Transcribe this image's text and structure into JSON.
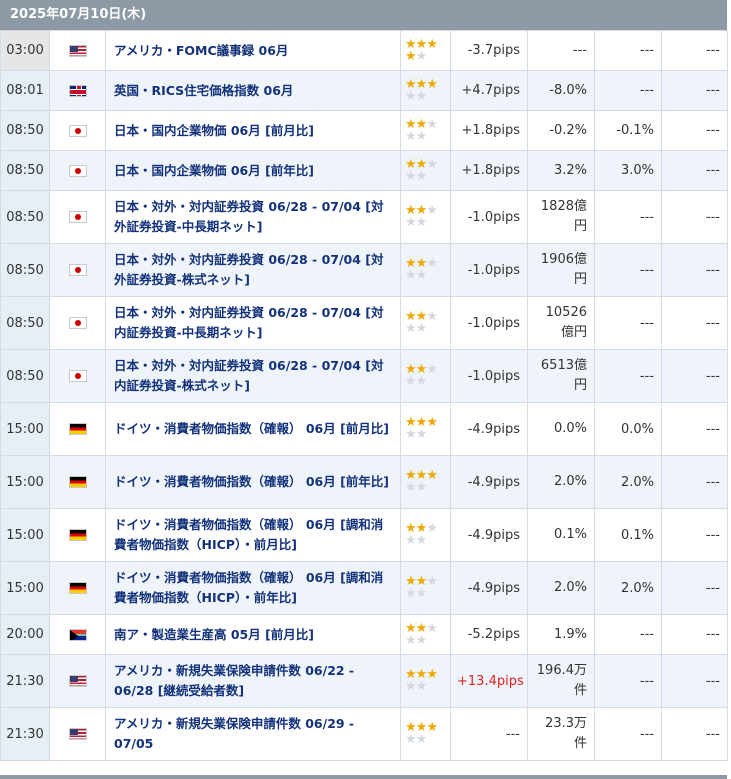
{
  "date_header": "2025年07月10日(木)",
  "rows": [
    {
      "time": "03:00",
      "country": "us",
      "name": "アメリカ・FOMC議事録 06月",
      "stars": 4,
      "pips": "-3.7pips",
      "pips_positive": false,
      "actual": "---",
      "forecast": "---",
      "previous": "---"
    },
    {
      "time": "08:01",
      "country": "gb",
      "name": "英国・RICS住宅価格指数 06月",
      "stars": 3,
      "pips": "+4.7pips",
      "pips_positive": false,
      "actual": "-8.0%",
      "forecast": "---",
      "previous": "---"
    },
    {
      "time": "08:50",
      "country": "jp",
      "name": "日本・国内企業物価 06月 [前月比]",
      "stars": 2,
      "pips": "+1.8pips",
      "pips_positive": false,
      "actual": "-0.2%",
      "forecast": "-0.1%",
      "previous": "---"
    },
    {
      "time": "08:50",
      "country": "jp",
      "name": "日本・国内企業物価 06月 [前年比]",
      "stars": 2,
      "pips": "+1.8pips",
      "pips_positive": false,
      "actual": "3.2%",
      "forecast": "3.0%",
      "previous": "---"
    },
    {
      "time": "08:50",
      "country": "jp",
      "name": "日本・対外・対内証券投資 06/28 - 07/04 [対外証券投資-中長期ネット]",
      "stars": 2,
      "pips": "-1.0pips",
      "pips_positive": false,
      "actual": "1828億円",
      "forecast": "---",
      "previous": "---"
    },
    {
      "time": "08:50",
      "country": "jp",
      "name": "日本・対外・対内証券投資 06/28 - 07/04 [対外証券投資-株式ネット]",
      "stars": 2,
      "pips": "-1.0pips",
      "pips_positive": false,
      "actual": "1906億円",
      "forecast": "---",
      "previous": "---"
    },
    {
      "time": "08:50",
      "country": "jp",
      "name": "日本・対外・対内証券投資 06/28 - 07/04 [対内証券投資-中長期ネット]",
      "stars": 2,
      "pips": "-1.0pips",
      "pips_positive": false,
      "actual": "10526億円",
      "forecast": "---",
      "previous": "---"
    },
    {
      "time": "08:50",
      "country": "jp",
      "name": "日本・対外・対内証券投資 06/28 - 07/04 [対内証券投資-株式ネット]",
      "stars": 2,
      "pips": "-1.0pips",
      "pips_positive": false,
      "actual": "6513億円",
      "forecast": "---",
      "previous": "---"
    },
    {
      "time": "15:00",
      "country": "de",
      "name": "ドイツ・消費者物価指数（確報） 06月 [前月比]",
      "stars": 3,
      "pips": "-4.9pips",
      "pips_positive": false,
      "actual": "0.0%",
      "forecast": "0.0%",
      "previous": "---"
    },
    {
      "time": "15:00",
      "country": "de",
      "name": "ドイツ・消費者物価指数（確報） 06月 [前年比]",
      "stars": 3,
      "pips": "-4.9pips",
      "pips_positive": false,
      "actual": "2.0%",
      "forecast": "2.0%",
      "previous": "---"
    },
    {
      "time": "15:00",
      "country": "de",
      "name": "ドイツ・消費者物価指数（確報） 06月 [調和消費者物価指数（HICP）・前月比]",
      "stars": 2,
      "pips": "-4.9pips",
      "pips_positive": false,
      "actual": "0.1%",
      "forecast": "0.1%",
      "previous": "---"
    },
    {
      "time": "15:00",
      "country": "de",
      "name": "ドイツ・消費者物価指数（確報） 06月 [調和消費者物価指数（HICP）・前年比]",
      "stars": 2,
      "pips": "-4.9pips",
      "pips_positive": false,
      "actual": "2.0%",
      "forecast": "2.0%",
      "previous": "---"
    },
    {
      "time": "20:00",
      "country": "za",
      "name": "南ア・製造業生産高 05月 [前月比]",
      "stars": 2,
      "pips": "-5.2pips",
      "pips_positive": false,
      "actual": "1.9%",
      "forecast": "---",
      "previous": "---"
    },
    {
      "time": "21:30",
      "country": "us",
      "name": "アメリカ・新規失業保険申請件数 06/22 - 06/28 [継続受給者数]",
      "stars": 3,
      "pips": "+13.4pips",
      "pips_positive": true,
      "actual": "196.4万件",
      "forecast": "---",
      "previous": "---"
    },
    {
      "time": "21:30",
      "country": "us",
      "name": "アメリカ・新規失業保険申請件数 06/29 - 07/05",
      "stars": 3,
      "pips": "---",
      "pips_positive": false,
      "actual": "23.3万件",
      "forecast": "---",
      "previous": "---"
    }
  ]
}
